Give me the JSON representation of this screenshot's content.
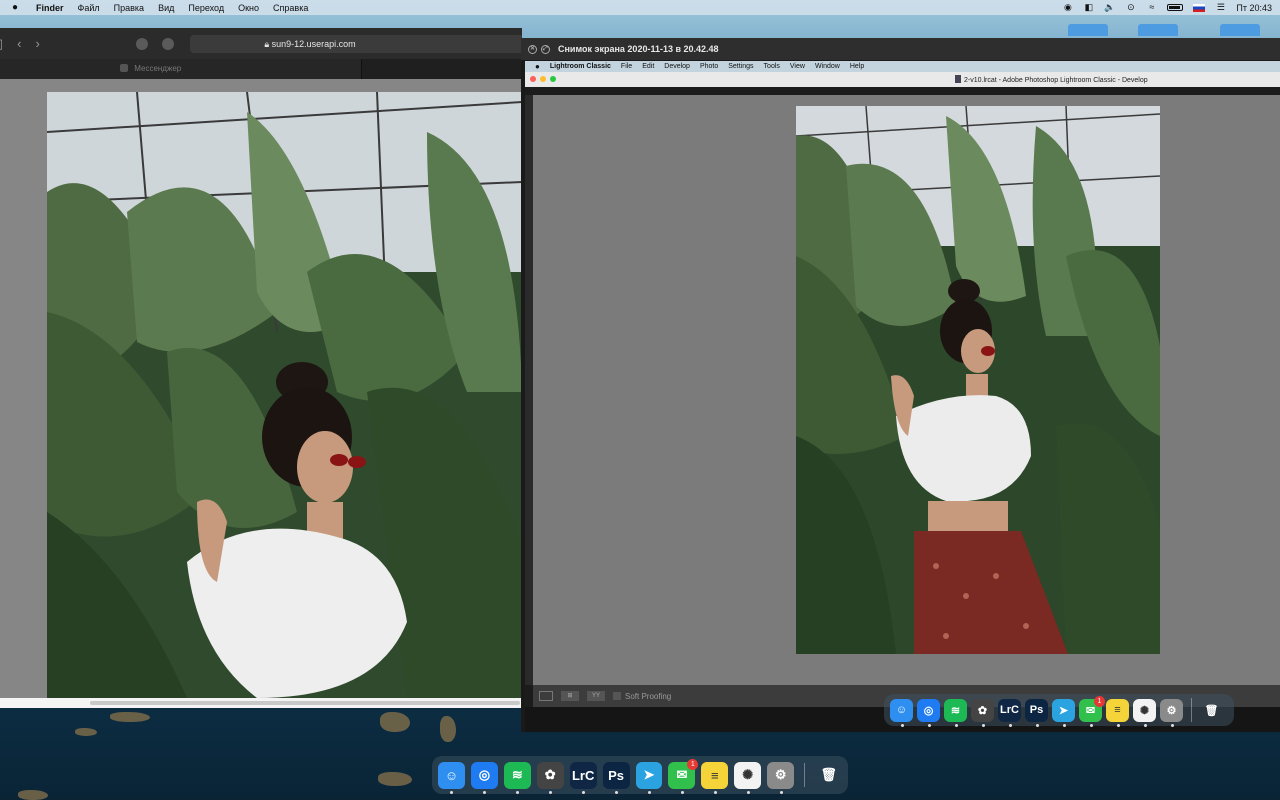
{
  "menubar": {
    "app": "Finder",
    "items": [
      "Файл",
      "Правка",
      "Вид",
      "Переход",
      "Окно",
      "Справка"
    ],
    "clock": "Пт 20:43"
  },
  "browser": {
    "url": "sun9-12.userapi.com",
    "tab_label": "Мессенджер"
  },
  "screenshot_window": {
    "title": "Снимок экрана 2020-11-13 в 20.42.48"
  },
  "lightroom": {
    "menu": [
      "Lightroom Classic",
      "File",
      "Edit",
      "Develop",
      "Photo",
      "Settings",
      "Tools",
      "View",
      "Window",
      "Help"
    ],
    "doc_title": "2-v10.lrcat - Adobe Photoshop Lightroom Classic - Develop",
    "soft_proofing": "Soft Proofing",
    "toolbar_compare": "YY"
  },
  "dock": {
    "items": [
      {
        "name": "finder-icon",
        "glyph": "☺",
        "color": "#2f8ff0"
      },
      {
        "name": "safari-icon",
        "glyph": "◎",
        "color": "#1e7bf2"
      },
      {
        "name": "spotify-icon",
        "glyph": "≋",
        "color": "#1db954"
      },
      {
        "name": "davinci-icon",
        "glyph": "✿",
        "color": "#444444"
      },
      {
        "name": "lightroom-icon",
        "glyph": "LrC",
        "color": "#0f2744"
      },
      {
        "name": "photoshop-icon",
        "glyph": "Ps",
        "color": "#0b2542"
      },
      {
        "name": "telegram-icon",
        "glyph": "➤",
        "color": "#2aa3e0"
      },
      {
        "name": "messages-icon",
        "glyph": "✉",
        "color": "#31c04c",
        "badge": "1"
      },
      {
        "name": "notes-icon",
        "glyph": "≡",
        "color": "#f5d43a"
      },
      {
        "name": "photos-icon",
        "glyph": "✺",
        "color": "#f3f3f3"
      },
      {
        "name": "system-preferences-icon",
        "glyph": "⚙",
        "color": "#8a8a8a"
      }
    ],
    "trash": {
      "name": "trash-icon",
      "glyph": "🗑"
    }
  }
}
